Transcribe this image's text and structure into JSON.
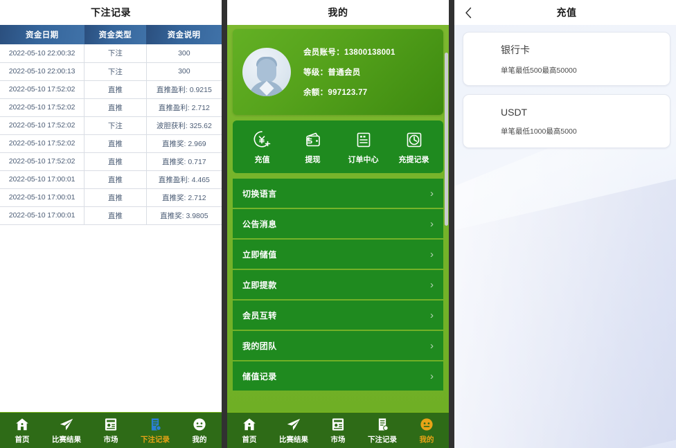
{
  "panel_records": {
    "title": "下注记录",
    "table": {
      "columns": [
        "资金日期",
        "资金类型",
        "资金说明"
      ],
      "rows": [
        [
          "2022-05-10 22:00:32",
          "下注",
          "300"
        ],
        [
          "2022-05-10 22:00:13",
          "下注",
          "300"
        ],
        [
          "2022-05-10 17:52:02",
          "直推",
          "直推盈利: 0.9215"
        ],
        [
          "2022-05-10 17:52:02",
          "直推",
          "直推盈利: 2.712"
        ],
        [
          "2022-05-10 17:52:02",
          "下注",
          "波胆获利: 325.62"
        ],
        [
          "2022-05-10 17:52:02",
          "直推",
          "直推奖: 2.969"
        ],
        [
          "2022-05-10 17:52:02",
          "直推",
          "直推奖: 0.717"
        ],
        [
          "2022-05-10 17:00:01",
          "直推",
          "直推盈利: 4.465"
        ],
        [
          "2022-05-10 17:00:01",
          "直推",
          "直推奖: 2.712"
        ],
        [
          "2022-05-10 17:00:01",
          "直推",
          "直推奖: 3.9805"
        ]
      ]
    },
    "tabs": [
      {
        "label": "首页",
        "icon": "home-icon",
        "active": false
      },
      {
        "label": "比赛结果",
        "icon": "paper-plane-icon",
        "active": false
      },
      {
        "label": "市场",
        "icon": "market-icon",
        "active": false
      },
      {
        "label": "下注记录",
        "icon": "clipboard-icon",
        "active": true
      },
      {
        "label": "我的",
        "icon": "face-icon",
        "active": false
      }
    ]
  },
  "panel_profile": {
    "title": "我的",
    "profile": {
      "account_label": "会员账号：13800138001",
      "level_label": "等级：普通会员",
      "balance_label": "余额：997123.77",
      "avatar": "user-avatar"
    },
    "quick_actions": [
      {
        "label": "充值",
        "icon": "yen-plus-icon"
      },
      {
        "label": "提现",
        "icon": "wallet-icon"
      },
      {
        "label": "订单中心",
        "icon": "order-icon"
      },
      {
        "label": "充提记录",
        "icon": "clock-icon"
      }
    ],
    "menu": [
      {
        "label": "切换语言"
      },
      {
        "label": "公告消息"
      },
      {
        "label": "立即储值"
      },
      {
        "label": "立即提款"
      },
      {
        "label": "会员互转"
      },
      {
        "label": "我的团队"
      },
      {
        "label": "储值记录"
      }
    ],
    "tabs": [
      {
        "label": "首页",
        "icon": "home-icon",
        "active": false
      },
      {
        "label": "比赛结果",
        "icon": "paper-plane-icon",
        "active": false
      },
      {
        "label": "市场",
        "icon": "market-icon",
        "active": false
      },
      {
        "label": "下注记录",
        "icon": "clipboard-icon",
        "active": false
      },
      {
        "label": "我的",
        "icon": "face-icon",
        "active": true
      }
    ]
  },
  "panel_recharge": {
    "title": "充值",
    "back_icon": "back-chevron-icon",
    "methods": [
      {
        "name": "银行卡",
        "limit": "单笔最低500最高50000"
      },
      {
        "name": "USDT",
        "limit": "单笔最低1000最高5000"
      }
    ]
  },
  "colors": {
    "table_header_blue": "#35659b",
    "table_text": "#4b5c75",
    "brand_green": "#1f8a1f",
    "page_green": "#7cb82f",
    "tabbar_green": "#2e6b17",
    "active_tab_orange": "#e8a317",
    "active_tab_icon_blue": "#2a7fd4",
    "divider_dark": "#313131"
  }
}
